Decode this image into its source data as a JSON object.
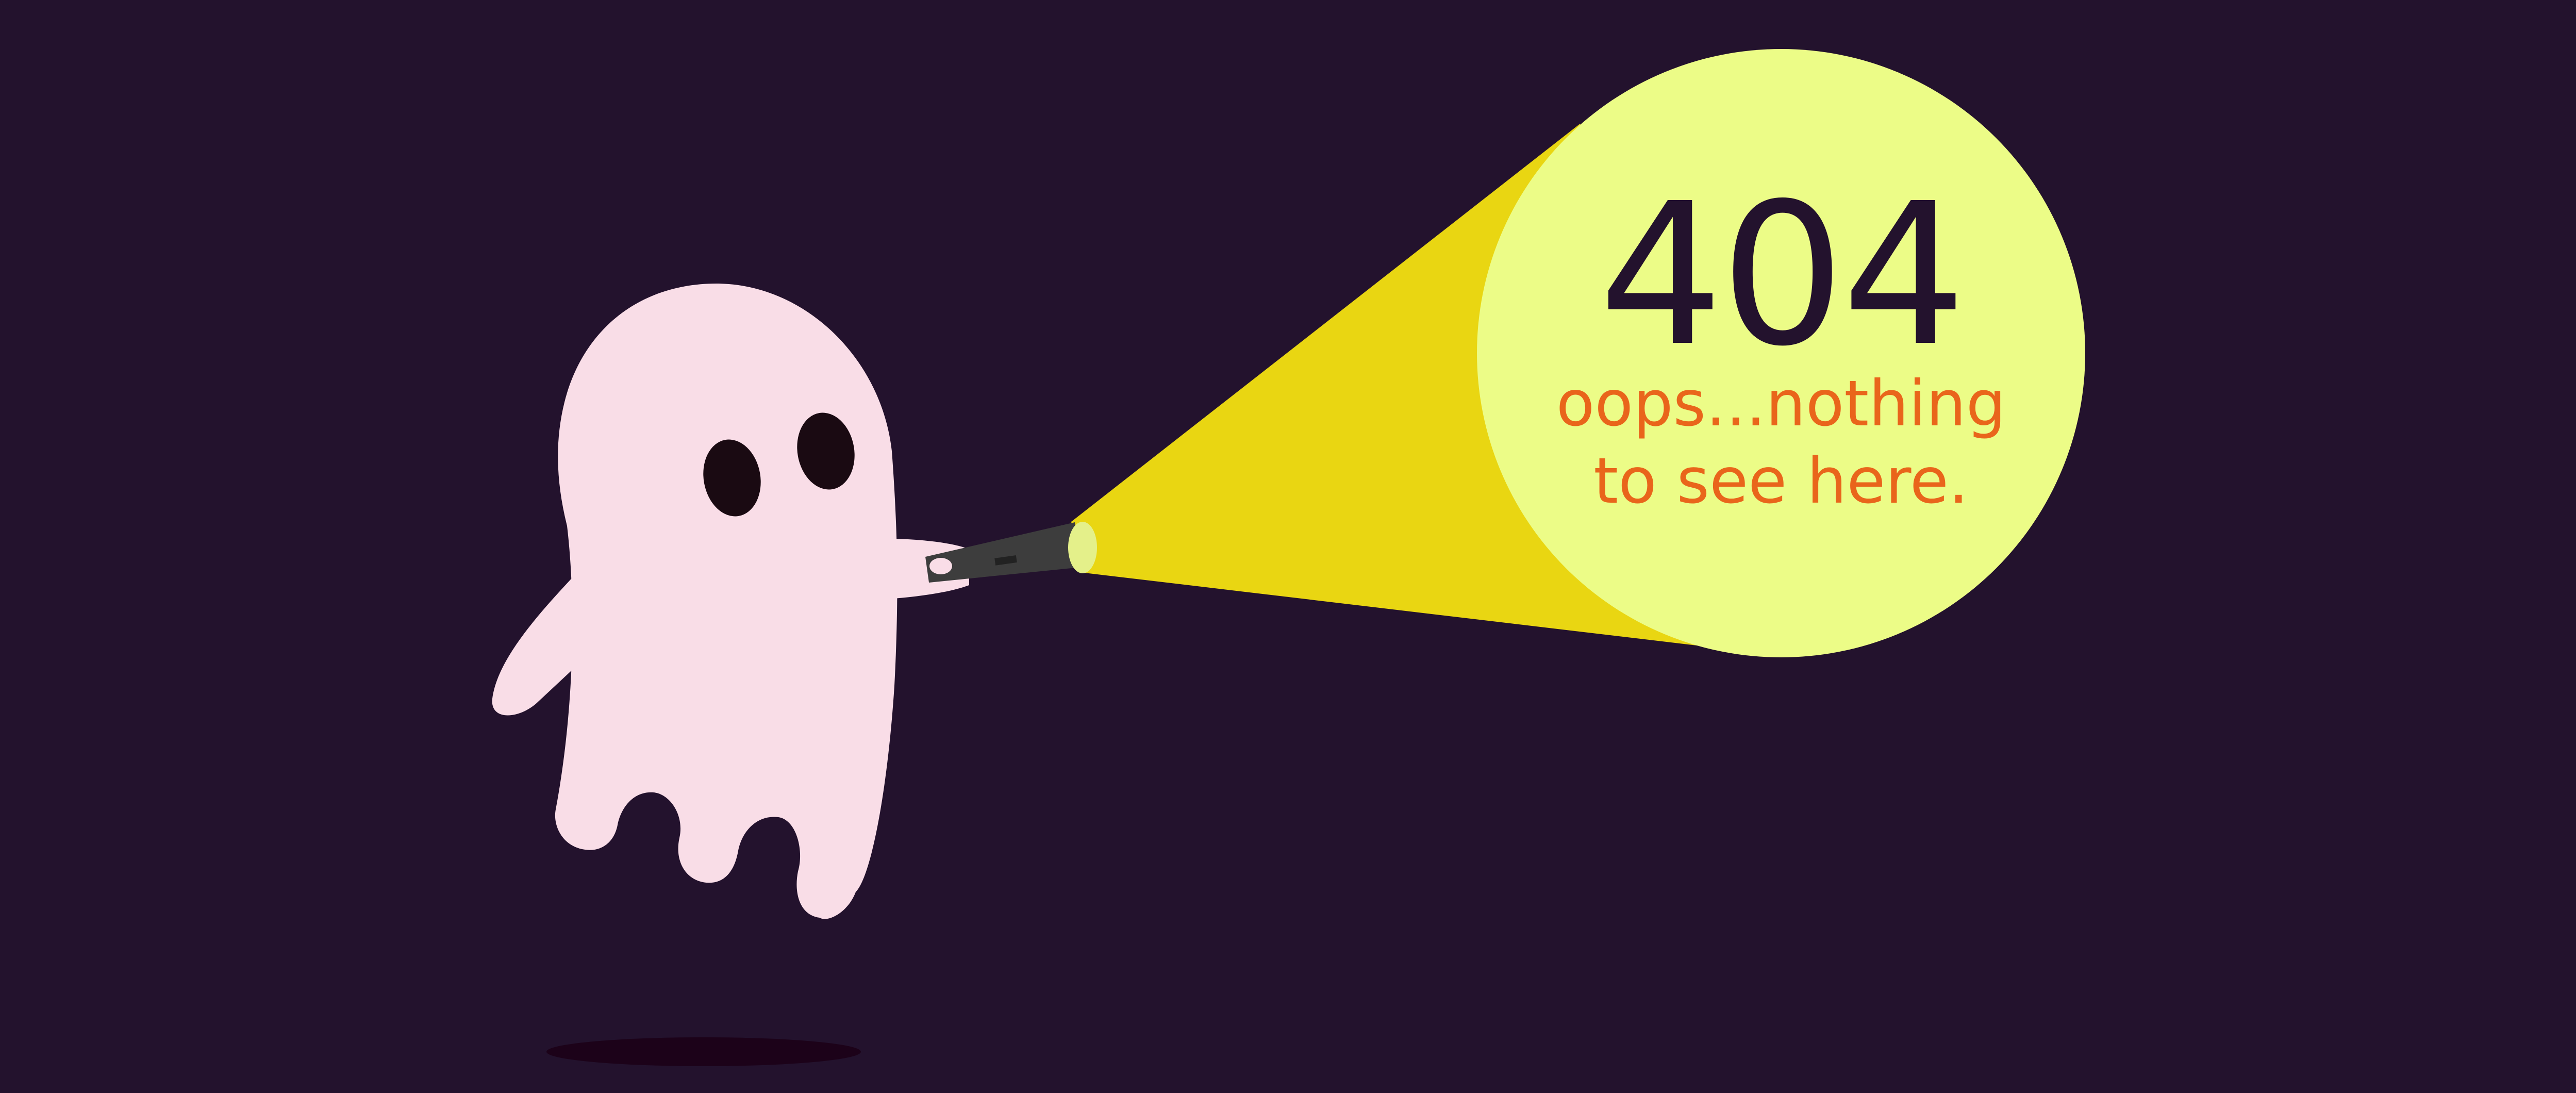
{
  "error": {
    "code": "404",
    "message_line1": "oops...nothing",
    "message_line2": "to see here."
  },
  "colors": {
    "background": "#23122d",
    "ghost_body": "#f9dde7",
    "ghost_eyes": "#1a0a12",
    "beam": "#e9d612",
    "spotlight": "#ecfc87",
    "flashlight": "#3d3d3d",
    "lens": "#e4f08a",
    "code_text": "#23122d",
    "message_text": "#e9651b",
    "shadow": "#1c0219"
  },
  "icons": {
    "character": "ghost-icon",
    "tool": "flashlight-icon"
  }
}
